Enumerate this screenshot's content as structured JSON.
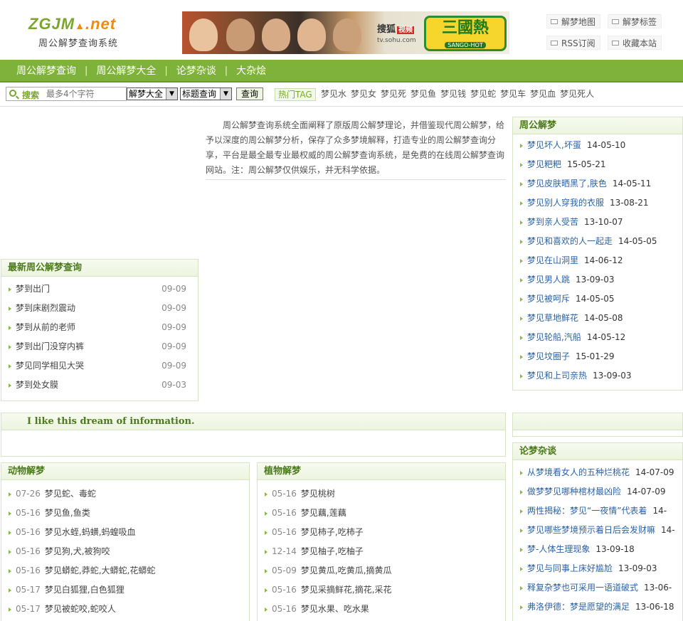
{
  "header": {
    "logo_main": "ZGJM",
    "logo_net": ".net",
    "logo_sub": "周公解梦查询系统",
    "banner": {
      "sohu_name": "搜狐",
      "sohu_badge": "视频",
      "sohu_url": "tv.sohu.com",
      "sango_title": "三國熱",
      "sango_sub": "SANGO-HOT"
    },
    "quick_links": [
      "解梦地图",
      "解梦标签",
      "RSS订阅",
      "收藏本站"
    ]
  },
  "nav": {
    "items": [
      "周公解梦查询",
      "周公解梦大全",
      "论梦杂谈",
      "大杂烩"
    ],
    "separator": "|"
  },
  "search": {
    "label": "搜索",
    "placeholder": "最多4个字符",
    "select1": "解梦大全",
    "select2": "标题查询",
    "button": "查询",
    "hot_tag_label": "热门TAG",
    "tags": [
      "梦见水",
      "梦见女",
      "梦见死",
      "梦见鱼",
      "梦见钱",
      "梦见蛇",
      "梦见车",
      "梦见血",
      "梦见死人"
    ]
  },
  "intro": "周公解梦查询系统全面阐释了原版周公解梦理论，并借鉴现代周公解梦，给予以深度的周公解梦分析，保存了众多梦境解释，打造专业的周公解梦查询分享，平台是最全最专业最权威的周公解梦查询系统，是免费的在线周公解梦查询网站。注：周公解梦仅供娱乐，并无科学依据。",
  "latest": {
    "title": "最新周公解梦查询",
    "items": [
      {
        "text": "梦到出门",
        "date": "09-09"
      },
      {
        "text": "梦到床剧烈震动",
        "date": "09-09"
      },
      {
        "text": "梦到从前的老师",
        "date": "09-09"
      },
      {
        "text": "梦到出门没穿内裤",
        "date": "09-09"
      },
      {
        "text": "梦见同学相见大哭",
        "date": "09-09"
      },
      {
        "text": "梦到处女膜",
        "date": "09-03"
      }
    ]
  },
  "zhougong": {
    "title": "周公解梦",
    "items": [
      {
        "text": "梦见坏人,坏蛋",
        "date": "14-05-10"
      },
      {
        "text": "梦见粑粑",
        "date": "15-05-21"
      },
      {
        "text": "梦见皮肤晒黑了,肤色",
        "date": "14-05-11"
      },
      {
        "text": "梦见别人穿我的衣服",
        "date": "13-08-21"
      },
      {
        "text": "梦到亲人受苦",
        "date": "13-10-07"
      },
      {
        "text": "梦见和喜欢的人一起走",
        "date": "14-05-05"
      },
      {
        "text": "梦见在山洞里",
        "date": "14-06-12"
      },
      {
        "text": "梦见男人跳",
        "date": "13-09-03"
      },
      {
        "text": "梦见被呵斥",
        "date": "14-05-05"
      },
      {
        "text": "梦见草地鲜花",
        "date": "14-05-08"
      },
      {
        "text": "梦见轮船,汽船",
        "date": "14-05-12"
      },
      {
        "text": "梦见坟圈子",
        "date": "15-01-29"
      },
      {
        "text": "梦见和上司亲热",
        "date": "13-09-03"
      }
    ]
  },
  "english_box": {
    "title": "I like this dream of information."
  },
  "animal": {
    "title": "动物解梦",
    "items": [
      {
        "date": "07-26",
        "text": "梦见蛇、毒蛇"
      },
      {
        "date": "05-16",
        "text": "梦见鱼,鱼类"
      },
      {
        "date": "05-16",
        "text": "梦见水蛭,蚂蟥,蚂蝗吸血"
      },
      {
        "date": "05-16",
        "text": "梦见狗,犬,被狗咬"
      },
      {
        "date": "05-16",
        "text": "梦见蟒蛇,莽蛇,大蟒蛇,花蟒蛇"
      },
      {
        "date": "05-17",
        "text": "梦见白狐狸,白色狐狸"
      },
      {
        "date": "05-17",
        "text": "梦见被蛇咬,蛇咬人"
      }
    ]
  },
  "plant": {
    "title": "植物解梦",
    "items": [
      {
        "date": "05-16",
        "text": "梦见桃树"
      },
      {
        "date": "05-16",
        "text": "梦见藕,莲藕"
      },
      {
        "date": "05-16",
        "text": "梦见柿子,吃柿子"
      },
      {
        "date": "12-14",
        "text": "梦见柚子,吃柚子"
      },
      {
        "date": "05-09",
        "text": "梦见黄瓜,吃黄瓜,摘黄瓜"
      },
      {
        "date": "05-16",
        "text": "梦见采摘鲜花,摘花,采花"
      },
      {
        "date": "05-16",
        "text": "梦见水果、吃水果"
      }
    ]
  },
  "lunmeng": {
    "title": "论梦杂谈",
    "items": [
      {
        "text": "从梦境看女人的五种烂桃花",
        "date": "14-07-09"
      },
      {
        "text": "做梦梦见哪种棺材最凶险",
        "date": "14-07-09"
      },
      {
        "text": "两性揭秘：梦见“一夜情”代表着",
        "date": "14-"
      },
      {
        "text": "梦见哪些梦境预示着日后会发财嘛",
        "date": "14-"
      },
      {
        "text": "梦-人体生理现象",
        "date": "13-09-18"
      },
      {
        "text": "梦见与同事上床好尴尬",
        "date": "13-09-03"
      },
      {
        "text": "释复杂梦也可采用一语道破式",
        "date": "13-06-"
      },
      {
        "text": "弗洛伊德：梦是愿望的满足",
        "date": "13-06-18"
      }
    ]
  },
  "colors": {
    "brand_green": "#7fb23a",
    "brand_orange": "#f08a16",
    "link_blue": "#2b63a8"
  }
}
